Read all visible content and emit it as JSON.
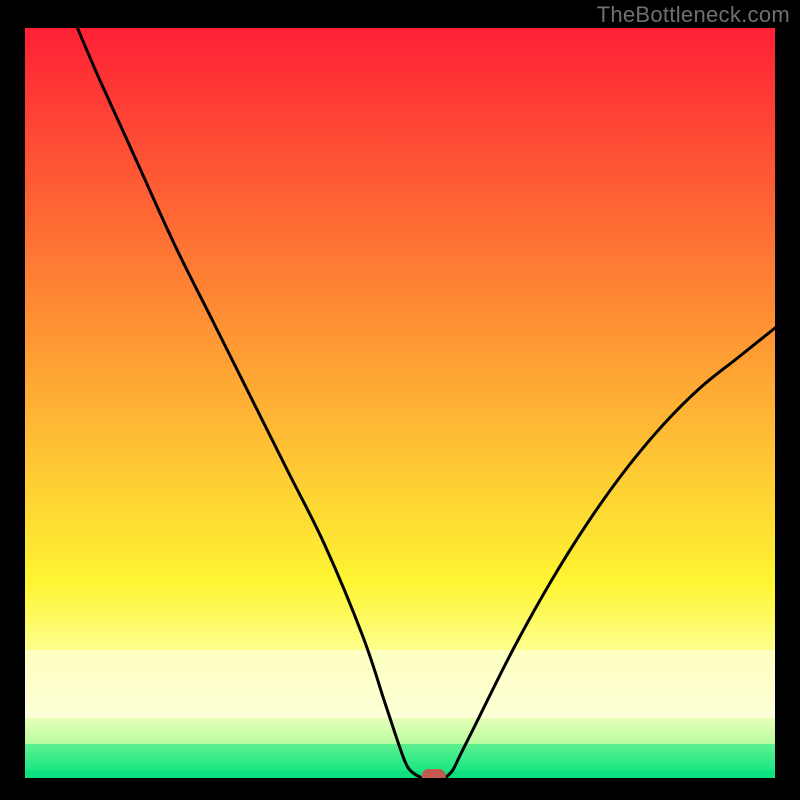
{
  "watermark": "TheBottleneck.com",
  "chart_data": {
    "type": "line",
    "title": "",
    "xlabel": "",
    "ylabel": "",
    "xlim": [
      0,
      100
    ],
    "ylim": [
      0,
      100
    ],
    "grid": false,
    "legend": false,
    "series": [
      {
        "name": "bottleneck-curve-left",
        "x": [
          7,
          10,
          15,
          20,
          25,
          30,
          35,
          40,
          45,
          48,
          50,
          51,
          52,
          53
        ],
        "y": [
          100,
          93,
          82,
          71,
          61,
          51,
          41,
          31,
          19,
          10,
          4,
          1.5,
          0.5,
          0
        ]
      },
      {
        "name": "bottleneck-curve-right",
        "x": [
          56,
          57,
          58,
          60,
          65,
          70,
          75,
          80,
          85,
          90,
          95,
          100
        ],
        "y": [
          0,
          1,
          3,
          7,
          17,
          26,
          34,
          41,
          47,
          52,
          56,
          60
        ]
      },
      {
        "name": "baseline",
        "x": [
          53,
          56
        ],
        "y": [
          0,
          0
        ]
      }
    ],
    "marker": {
      "x": 54.5,
      "y": 0,
      "color": "#c35a52",
      "shape": "rounded-rect"
    },
    "gradient_bands": [
      {
        "from": 0.0,
        "to": 0.74,
        "top": "#fe2035",
        "bottom": "#fef533"
      },
      {
        "from": 0.74,
        "to": 0.83,
        "top": "#fef533",
        "bottom": "#feff8c"
      },
      {
        "from": 0.83,
        "to": 0.92,
        "top": "#feffc0",
        "bottom": "#fdffd7"
      },
      {
        "from": 0.92,
        "to": 0.955,
        "top": "#e6ffb8",
        "bottom": "#b8fca0"
      },
      {
        "from": 0.955,
        "to": 0.99,
        "top": "#5ef18f",
        "bottom": "#17e782"
      },
      {
        "from": 0.99,
        "to": 1.0,
        "top": "#0ee07f",
        "bottom": "#0ee07f"
      }
    ]
  }
}
